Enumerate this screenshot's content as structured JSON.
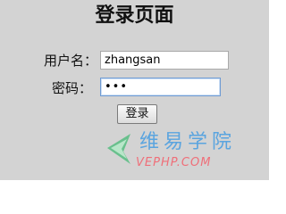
{
  "login": {
    "title": "登录页面",
    "username_label": "用户名：",
    "username_value": "zhangsan",
    "password_label": "密码：",
    "password_mask": "•••",
    "submit_label": "登录"
  },
  "watermark": {
    "name_cn": "维易学院",
    "name_en": "VEPHP.COM",
    "logo_icon": "green-swoosh-logo-icon"
  },
  "colors": {
    "page_background": "#d3d3d3",
    "watermark_blue": "#5aa4df",
    "watermark_pink": "#ef6f79",
    "watermark_green": "#69c08d"
  }
}
